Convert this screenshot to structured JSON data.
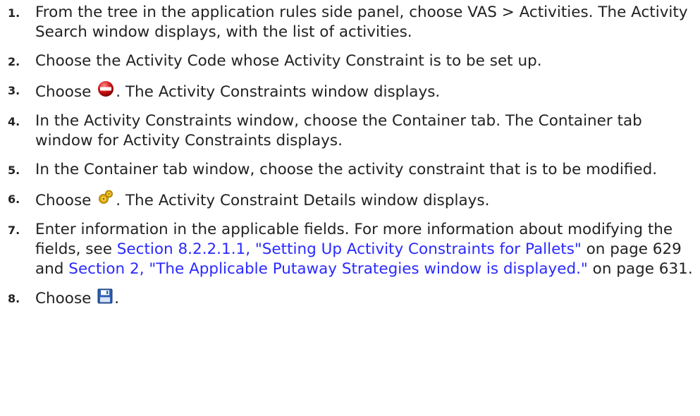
{
  "steps": [
    {
      "number": "1.",
      "text": "From the tree in the application rules side panel, choose VAS > Activities. The Activity Search window displays, with the list of activities."
    },
    {
      "number": "2.",
      "text": "Choose the Activity Code whose Activity Constraint is to be set up."
    },
    {
      "number": "3.",
      "before": "Choose ",
      "icon": "constraint-icon",
      "after": ". The Activity Constraints window displays."
    },
    {
      "number": "4.",
      "text": "In the Activity Constraints window, choose the Container tab. The Container tab window for Activity Constraints displays."
    },
    {
      "number": "5.",
      "text": "In the Container tab window, choose the activity constraint that is to be modified."
    },
    {
      "number": "6.",
      "before": "Choose ",
      "icon": "gear-icon",
      "after": ". The Activity Constraint Details window displays."
    },
    {
      "number": "7.",
      "text_start": "Enter information in the applicable fields. For more information about modifying the fields, see ",
      "link1": "Section 8.2.2.1.1, \"Setting Up Activity Constraints for Pallets\"",
      "middle": " on page 629 and ",
      "link2": "Section 2, \"The Applicable Putaway Strategies window is displayed.\"",
      "end": " on page 631."
    },
    {
      "number": "8.",
      "before": "Choose ",
      "icon": "save-icon",
      "after": "."
    }
  ],
  "colors": {
    "text": "#222222",
    "link": "#2a2aff",
    "constraint_icon": "#cc1111",
    "gear_icon": "#d9a300",
    "save_icon": "#2b5fb0"
  }
}
